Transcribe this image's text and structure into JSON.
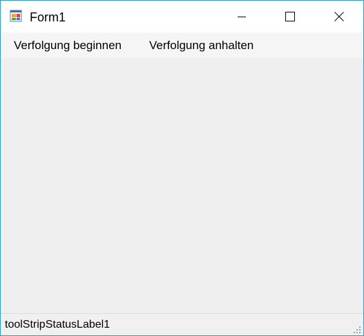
{
  "window": {
    "title": "Form1",
    "icon": "form-app-icon",
    "controls": {
      "minimize_icon": "minimize-icon",
      "maximize_icon": "maximize-icon",
      "close_icon": "close-icon"
    }
  },
  "menu": {
    "items": [
      {
        "label": "Verfolgung beginnen"
      },
      {
        "label": "Verfolgung anhalten"
      }
    ]
  },
  "status": {
    "label": "toolStripStatusLabel1",
    "grip_icon": "resize-grip-icon"
  },
  "colors": {
    "window_border": "#2b9dbd",
    "titlebar": "#ffffff",
    "menubar": "#f5f5f5",
    "client": "#efefef",
    "statusbar": "#f0f0f0"
  }
}
